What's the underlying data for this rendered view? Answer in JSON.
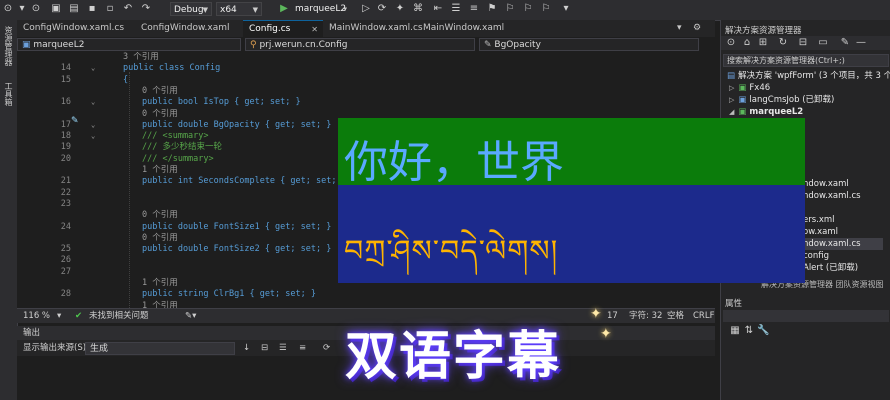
{
  "toolbar": {
    "config_value": "Debug",
    "platform_value": "x64",
    "project_value": "marqueeL2"
  },
  "left_tool": {
    "item1": "资源管理器",
    "item2": "工具箱"
  },
  "tabs": [
    {
      "label": "ConfigWindow.xaml.cs"
    },
    {
      "label": "ConfigWindow.xaml"
    },
    {
      "label": "Config.cs"
    },
    {
      "label": "MainWindow.xaml.cs"
    },
    {
      "label": "MainWindow.xaml"
    }
  ],
  "nav": {
    "project": "marqueeL2",
    "class": "prj.werun.cn.Config",
    "member": "BgOpacity"
  },
  "code_lines": [
    {
      "num": "",
      "text": "3 个引用"
    },
    {
      "num": "14",
      "text": "public class Config"
    },
    {
      "num": "15",
      "text": "{"
    },
    {
      "num": "",
      "text": "0 个引用"
    },
    {
      "num": "16",
      "text": "public bool IsTop { get; set; }"
    },
    {
      "num": "",
      "text": "0 个引用"
    },
    {
      "num": "17",
      "text": "public double BgOpacity { get; set; }"
    },
    {
      "num": "18",
      "text": "/// <summary>"
    },
    {
      "num": "19",
      "text": "/// 多少秒结束一轮"
    },
    {
      "num": "20",
      "text": "/// </summary>"
    },
    {
      "num": "",
      "text": "1 个引用"
    },
    {
      "num": "21",
      "text": "public int SecondsComplete { get; set; }"
    },
    {
      "num": "22",
      "text": ""
    },
    {
      "num": "23",
      "text": ""
    },
    {
      "num": "",
      "text": "0 个引用"
    },
    {
      "num": "24",
      "text": "public double FontSize1 { get; set; }"
    },
    {
      "num": "",
      "text": "0 个引用"
    },
    {
      "num": "25",
      "text": "public double FontSize2 { get; set; }"
    },
    {
      "num": "26",
      "text": ""
    },
    {
      "num": "27",
      "text": ""
    },
    {
      "num": "",
      "text": "1 个引用"
    },
    {
      "num": "28",
      "text": "public string ClrBg1 { get; set; }"
    },
    {
      "num": "",
      "text": "1 个引用"
    }
  ],
  "status": {
    "zoom": "116 %",
    "issues": "未找到相关问题",
    "position": "字符: 32",
    "position_partial": "17",
    "spaces": "空格",
    "eol": "CRLF"
  },
  "output": {
    "title": "输出",
    "source_label": "显示输出来源(S):",
    "source_value": "生成"
  },
  "solution_explorer": {
    "title": "解决方案资源管理器",
    "search_placeholder": "搜索解决方案资源管理器(Ctrl+;)",
    "items": [
      {
        "label": "解决方案 'wpfForm' (3 个项目，共 3 个)"
      },
      {
        "label": "Fx46"
      },
      {
        "label": "langCmsJob (已卸载)"
      },
      {
        "label": "marqueeL2"
      },
      {
        "label": "ndow.xaml"
      },
      {
        "label": "ndow.xaml.cs"
      },
      {
        "label": "ers.xml"
      },
      {
        "label": "ow.xaml"
      },
      {
        "label": "ndow.xaml.cs"
      },
      {
        "label": "config"
      },
      {
        "label": "Alert (已卸载)"
      }
    ],
    "bottom_tabs": "解决方案资源管理器   团队资源视图",
    "properties_title": "属性"
  },
  "overlay": {
    "line1": "你好，世界",
    "line2": "བཀྲ་ཤིས་བདེ་ལེགས།",
    "caption": "双语字幕",
    "colors": {
      "top": "#0b7c0b",
      "bottom": "#1c2a8c",
      "text1": "#5aa9ff",
      "text2": "#ffb400"
    }
  }
}
